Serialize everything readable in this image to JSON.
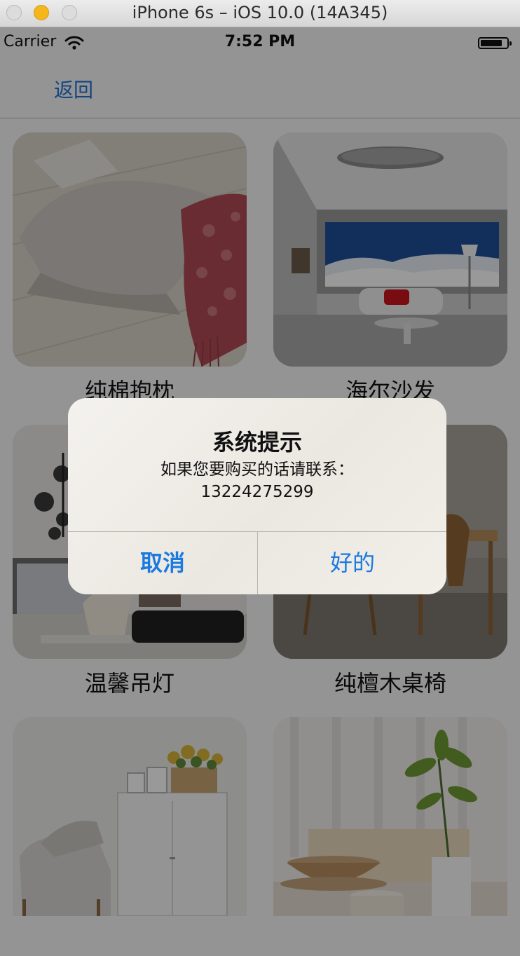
{
  "window": {
    "title": "iPhone 6s – iOS 10.0 (14A345)"
  },
  "status_bar": {
    "carrier": "Carrier",
    "time": "7:52 PM"
  },
  "nav": {
    "back_label": "返回"
  },
  "products": [
    {
      "label": "纯棉抱枕"
    },
    {
      "label": "海尔沙发"
    },
    {
      "label": "温馨吊灯"
    },
    {
      "label": "纯檀木桌椅"
    },
    {
      "label": ""
    },
    {
      "label": ""
    }
  ],
  "alert": {
    "title": "系统提示",
    "message": "如果您要购买的话请联系：\n13224275299",
    "cancel_label": "取消",
    "ok_label": "好的"
  },
  "colors": {
    "accent": "#1a7ae0",
    "back_link": "#1e74d6"
  }
}
